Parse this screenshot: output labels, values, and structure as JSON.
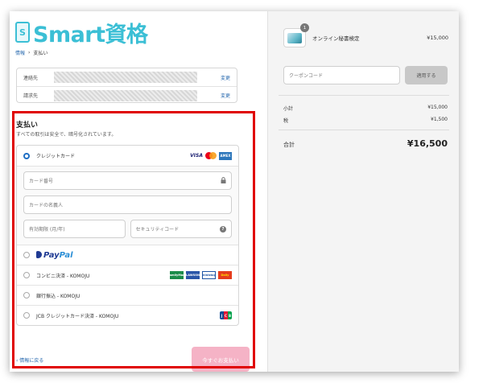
{
  "header": {
    "logo_letter": "S",
    "logo_text": "Smart資格"
  },
  "breadcrumb": {
    "info": "情報",
    "separator": "›",
    "payment": "支払い"
  },
  "contact": {
    "rows": [
      {
        "label": "連絡先",
        "change": "変更"
      },
      {
        "label": "請求先",
        "change": "変更"
      }
    ]
  },
  "payment": {
    "title": "支払い",
    "subtitle": "すべての取引は安全で、暗号化されています。",
    "credit_card": {
      "label": "クレジットカード",
      "logos": {
        "visa": "VISA",
        "amex": "AMEX"
      },
      "fields": {
        "card_number": "カード番号",
        "card_name": "カードの名義人",
        "expiry": "有効期限 (月/年)",
        "security_code": "セキュリティコード"
      }
    },
    "paypal": {
      "pay": "Pay",
      "pal": "Pal"
    },
    "konbini": {
      "label": "コンビニ決済 - KOMOJU",
      "stores": [
        "FamilyMart",
        "LAWSON",
        "ministop",
        "Daily"
      ]
    },
    "bank": {
      "label": "銀行振込 - KOMOJU"
    },
    "jcb": {
      "label": "JCB クレジットカード決済 - KOMOJU",
      "logo": [
        "J",
        "C",
        "B"
      ]
    },
    "help_icon": "?"
  },
  "footer": {
    "back_link": "‹ 情報に戻る",
    "pay_button": "今すぐお支払い"
  },
  "summary": {
    "product": {
      "name": "オンライン秘書検定",
      "price": "¥15,000",
      "quantity": "1"
    },
    "coupon": {
      "placeholder": "クーポンコード",
      "apply": "適用する"
    },
    "subtotal": {
      "label": "小計",
      "value": "¥15,000"
    },
    "tax": {
      "label": "税",
      "value": "¥1,500"
    },
    "total": {
      "label": "合計",
      "value": "¥16,500"
    }
  },
  "colors": {
    "brand": "#3bbfd5",
    "highlight": "#e00000",
    "pay_button": "#f5b3c6",
    "link": "#2b6cb0"
  }
}
